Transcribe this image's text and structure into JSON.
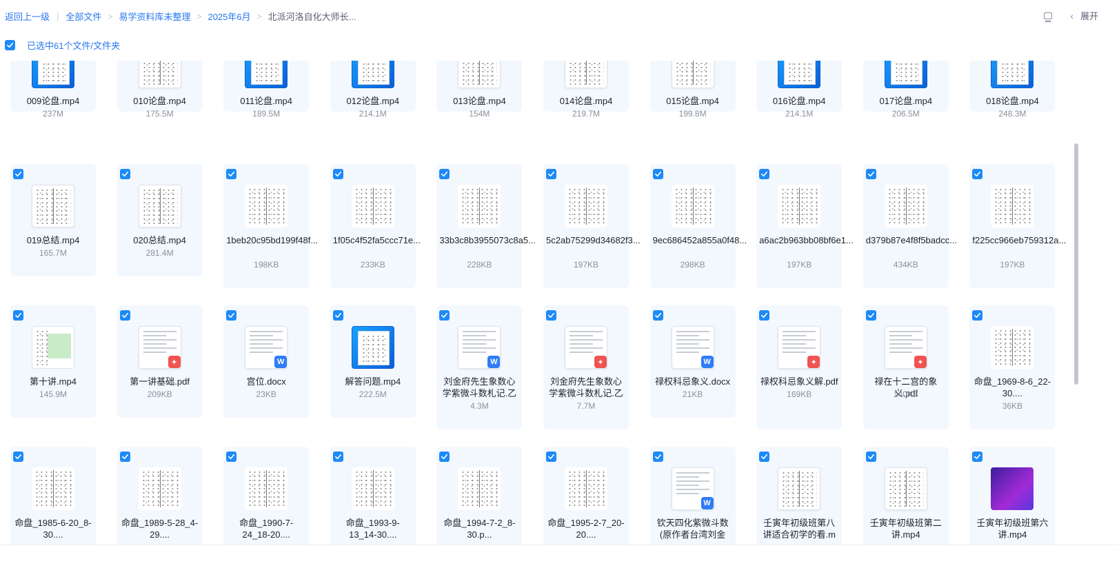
{
  "breadcrumb": {
    "back": "返回上一级",
    "items": [
      "全部文件",
      "易学资料库未整理",
      "2025年6月",
      "北派河洛自化大师长..."
    ]
  },
  "toolbar": {
    "expand_label": "展开"
  },
  "selection": {
    "label": "已选中61个文件/文件夹"
  },
  "rows": [
    {
      "checked": false,
      "items": [
        {
          "name": "009论盘.mp4",
          "size": "237M",
          "type": "video"
        },
        {
          "name": "010论盘.mp4",
          "size": "175.5M",
          "type": "doc"
        },
        {
          "name": "011论盘.mp4",
          "size": "189.5M",
          "type": "video"
        },
        {
          "name": "012论盘.mp4",
          "size": "214.1M",
          "type": "video"
        },
        {
          "name": "013论盘.mp4",
          "size": "154M",
          "type": "doc"
        },
        {
          "name": "014论盘.mp4",
          "size": "219.7M",
          "type": "doc"
        },
        {
          "name": "015论盘.mp4",
          "size": "199.8M",
          "type": "doc"
        },
        {
          "name": "016论盘.mp4",
          "size": "214.1M",
          "type": "video"
        },
        {
          "name": "017论盘.mp4",
          "size": "206.5M",
          "type": "video"
        },
        {
          "name": "018论盘.mp4",
          "size": "248.3M",
          "type": "video"
        }
      ]
    },
    {
      "checked": true,
      "items": [
        {
          "name": "019总结.mp4",
          "size": "165.7M",
          "type": "doc"
        },
        {
          "name": "020总结.mp4",
          "size": "281.4M",
          "type": "doc"
        },
        {
          "name": "1beb20c95bd199f48f...",
          "size": "198KB",
          "type": "img"
        },
        {
          "name": "1f05c4f52fa5ccc71e...",
          "size": "233KB",
          "type": "img"
        },
        {
          "name": "33b3c8b3955073c8a5...",
          "size": "228KB",
          "type": "img"
        },
        {
          "name": "5c2ab75299d34682f3...",
          "size": "197KB",
          "type": "img"
        },
        {
          "name": "9ec686452a855a0f48...",
          "size": "298KB",
          "type": "img"
        },
        {
          "name": "a6ac2b963bb08bf6e1...",
          "size": "197KB",
          "type": "img"
        },
        {
          "name": "d379b87e4f8f5badcc...",
          "size": "434KB",
          "type": "img"
        },
        {
          "name": "f225cc966eb759312a...",
          "size": "197KB",
          "type": "img"
        }
      ]
    },
    {
      "checked": true,
      "items": [
        {
          "name": "第十讲.mp4",
          "size": "145.9M",
          "type": "green"
        },
        {
          "name": "第一讲基础.pdf",
          "size": "209KB",
          "type": "pdf"
        },
        {
          "name": "宫位.docx",
          "size": "23KB",
          "type": "word"
        },
        {
          "name": "解答问题.mp4",
          "size": "222.5M",
          "type": "video"
        },
        {
          "name": "刘金府先生象数心学紫微斗数札记.乙",
          "size": "4.3M",
          "type": "word"
        },
        {
          "name": "刘金府先生象数心学紫微斗数札记.乙",
          "size": "7.7M",
          "type": "pdf"
        },
        {
          "name": "禄权科忌象义.docx",
          "size": "21KB",
          "type": "word"
        },
        {
          "name": "禄权科忌象义解.pdf",
          "size": "169KB",
          "type": "pdf"
        },
        {
          "name": "禄在十二宫的象义.pdf",
          "size": "140KB",
          "type": "pdf"
        },
        {
          "name": "命盘_1969-8-6_22-30....",
          "size": "36KB",
          "type": "img"
        }
      ]
    },
    {
      "checked": true,
      "items": [
        {
          "name": "命盘_1985-6-20_8-30....",
          "size": "",
          "type": "img"
        },
        {
          "name": "命盘_1989-5-28_4-29....",
          "size": "",
          "type": "img"
        },
        {
          "name": "命盘_1990-7-24_18-20....",
          "size": "",
          "type": "img"
        },
        {
          "name": "命盘_1993-9-13_14-30....",
          "size": "",
          "type": "img"
        },
        {
          "name": "命盘_1994-7-2_8-30.p...",
          "size": "",
          "type": "img"
        },
        {
          "name": "命盘_1995-2-7_20-20....",
          "size": "",
          "type": "img"
        },
        {
          "name": "钦天四化紫微斗数(原作者台湾刘金",
          "size": "",
          "type": "word"
        },
        {
          "name": "壬寅年初级班第八讲适合初学的看.m",
          "size": "",
          "type": "doc"
        },
        {
          "name": "壬寅年初级班第二讲.mp4",
          "size": "",
          "type": "doc"
        },
        {
          "name": "壬寅年初级班第六讲.mp4",
          "size": "",
          "type": "purple"
        }
      ]
    }
  ]
}
